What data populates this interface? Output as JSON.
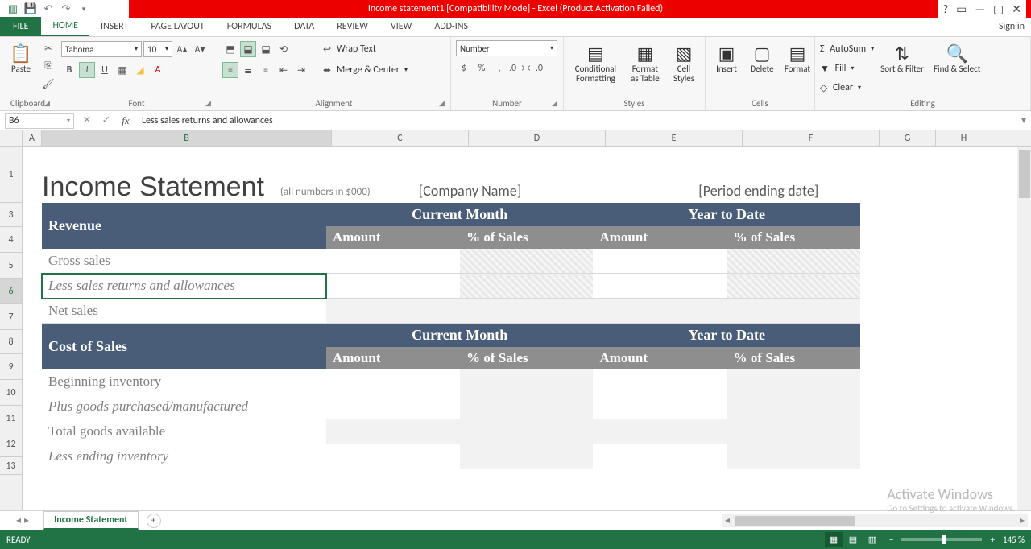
{
  "titlebar": {
    "title": "Income statement1  [Compatibility Mode] -  Excel (Product Activation Failed)"
  },
  "signin": "Sign in",
  "tabs": {
    "file": "FILE",
    "home": "HOME",
    "insert": "INSERT",
    "pagelayout": "PAGE LAYOUT",
    "formulas": "FORMULAS",
    "data": "DATA",
    "review": "REVIEW",
    "view": "VIEW",
    "addins": "ADD-INS"
  },
  "ribbon": {
    "clipboard": {
      "paste": "Paste",
      "label": "Clipboard"
    },
    "font": {
      "name": "Tahoma",
      "size": "10",
      "label": "Font"
    },
    "alignment": {
      "wrap": "Wrap Text",
      "merge": "Merge & Center",
      "label": "Alignment"
    },
    "number": {
      "format": "Number",
      "label": "Number"
    },
    "styles": {
      "cond": "Conditional Formatting",
      "fmtTable": "Format as Table",
      "cellStyles": "Cell Styles",
      "label": "Styles"
    },
    "cells": {
      "insert": "Insert",
      "delete": "Delete",
      "format": "Format",
      "label": "Cells"
    },
    "editing": {
      "autosum": "AutoSum",
      "fill": "Fill",
      "clear": "Clear",
      "sort": "Sort & Filter",
      "find": "Find & Select",
      "label": "Editing"
    }
  },
  "namebox": "B6",
  "formula": "Less sales returns and allowances",
  "columns": {
    "A": "A",
    "B": "B",
    "C": "C",
    "D": "D",
    "E": "E",
    "F": "F",
    "G": "G",
    "H": "H"
  },
  "rows": [
    "1",
    "3",
    "4",
    "5",
    "6",
    "7",
    "8",
    "9",
    "10",
    "11",
    "12",
    "13"
  ],
  "sheet": {
    "title": "Income Statement",
    "note": "(all numbers in $000)",
    "company": "[Company Name]",
    "period": "[Period ending date]",
    "revenue": "Revenue",
    "curMonth": "Current Month",
    "ytd": "Year to Date",
    "amount": "Amount",
    "pctSales": "% of Sales",
    "grossSales": "Gross sales",
    "lessReturns": "Less sales returns and allowances",
    "netSales": "Net sales",
    "costOfSales": "Cost of Sales",
    "begInv": "Beginning inventory",
    "plusGoods": "Plus goods purchased/manufactured",
    "totalGoods": "Total goods available",
    "lessEnd": "Less ending inventory"
  },
  "sheetTab": "Income Statement",
  "status": {
    "ready": "READY",
    "zoom": "145 %"
  },
  "watermark": {
    "t": "Activate Windows",
    "s": "Go to Settings to activate Windows."
  }
}
